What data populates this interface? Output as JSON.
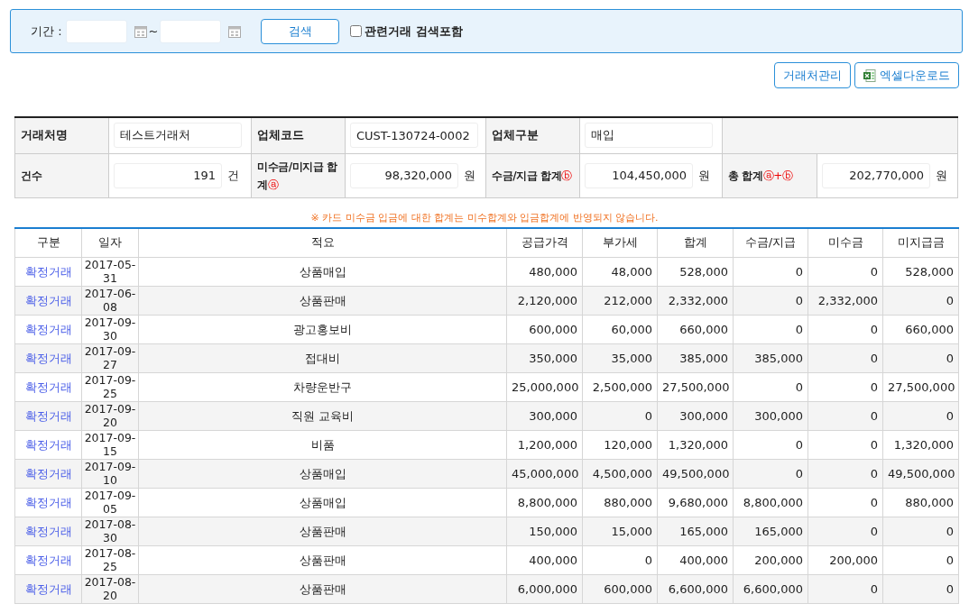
{
  "filter": {
    "period_label": "기간 :",
    "separator": "~",
    "search_button": "검색",
    "include_related": {
      "label": "관련거래 검색포함",
      "checked": false
    }
  },
  "actions": [
    "거래처관리",
    "엑셀다운로드"
  ],
  "summary": {
    "row1": [
      {
        "label": "거래처명",
        "value": "테스트거래처"
      },
      {
        "label": "업체코드",
        "value": "CUST-130724-0002"
      },
      {
        "label": "업체구분",
        "value": "매입"
      }
    ],
    "row2": [
      {
        "label": "건수",
        "value": "191",
        "unit": "건"
      },
      {
        "label": "미수금/미지급 합계",
        "mark": "ⓐ",
        "value": "98,320,000",
        "unit": "원"
      },
      {
        "label": "수금/지급 합계",
        "mark": "ⓑ",
        "value": "104,450,000",
        "unit": "원"
      },
      {
        "label": "총 합계",
        "mark": "ⓐ+ⓑ",
        "value": "202,770,000",
        "unit": "원"
      }
    ]
  },
  "notice": "※ 카드 미수금 입금에 대한 합계는 미수합계와 입금합계에 반영되지 않습니다.",
  "table": {
    "columns": [
      "구분",
      "일자",
      "적요",
      "공급가격",
      "부가세",
      "합계",
      "수금/지급",
      "미수금",
      "미지급금"
    ],
    "rows": [
      [
        "확정거래",
        "2017-05-31",
        "상품매입",
        "480,000",
        "48,000",
        "528,000",
        "0",
        "0",
        "528,000"
      ],
      [
        "확정거래",
        "2017-06-08",
        "상품판매",
        "2,120,000",
        "212,000",
        "2,332,000",
        "0",
        "2,332,000",
        "0"
      ],
      [
        "확정거래",
        "2017-09-30",
        "광고홍보비",
        "600,000",
        "60,000",
        "660,000",
        "0",
        "0",
        "660,000"
      ],
      [
        "확정거래",
        "2017-09-27",
        "접대비",
        "350,000",
        "35,000",
        "385,000",
        "385,000",
        "0",
        "0"
      ],
      [
        "확정거래",
        "2017-09-25",
        "차량운반구",
        "25,000,000",
        "2,500,000",
        "27,500,000",
        "0",
        "0",
        "27,500,000"
      ],
      [
        "확정거래",
        "2017-09-20",
        "직원 교육비",
        "300,000",
        "0",
        "300,000",
        "300,000",
        "0",
        "0"
      ],
      [
        "확정거래",
        "2017-09-15",
        "비품",
        "1,200,000",
        "120,000",
        "1,320,000",
        "0",
        "0",
        "1,320,000"
      ],
      [
        "확정거래",
        "2017-09-10",
        "상품매입",
        "45,000,000",
        "4,500,000",
        "49,500,000",
        "0",
        "0",
        "49,500,000"
      ],
      [
        "확정거래",
        "2017-09-05",
        "상품매입",
        "8,800,000",
        "880,000",
        "9,680,000",
        "8,800,000",
        "0",
        "880,000"
      ],
      [
        "확정거래",
        "2017-08-30",
        "상품판매",
        "150,000",
        "15,000",
        "165,000",
        "165,000",
        "0",
        "0"
      ],
      [
        "확정거래",
        "2017-08-25",
        "상품판매",
        "400,000",
        "0",
        "400,000",
        "200,000",
        "200,000",
        "0"
      ],
      [
        "확정거래",
        "2017-08-20",
        "상품판매",
        "6,000,000",
        "600,000",
        "6,600,000",
        "6,600,000",
        "0",
        "0"
      ]
    ]
  }
}
